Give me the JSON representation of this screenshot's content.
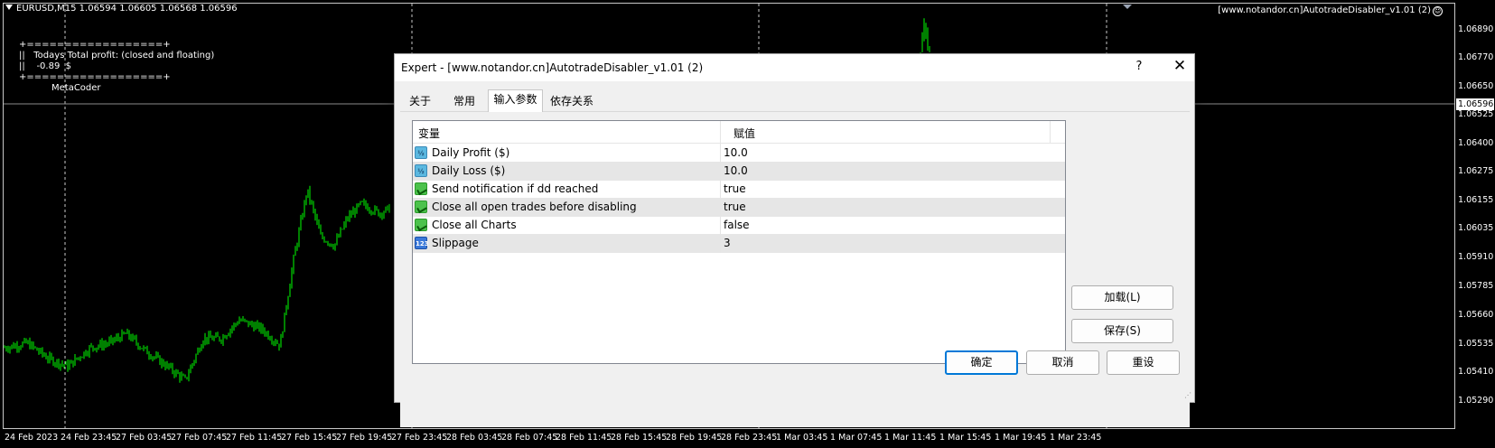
{
  "chart": {
    "title": "EURUSD,M15  1.06594 1.06605 1.06568 1.06596",
    "ea_label": "[www.notandor.cn]AutotradeDisabler_v1.01 (2)",
    "smiley": "☺",
    "overlay": {
      "line1": "+==================+",
      "line2": "||   Todays Total profit: (closed and floating)",
      "line3": "||    -0.89  $",
      "line4": "+==================+",
      "line5": "MetaCoder"
    },
    "price_labels": [
      "1.06890",
      "1.06770",
      "1.06650",
      "1.06525",
      "1.06400",
      "1.06275",
      "1.06155",
      "1.06035",
      "1.05910",
      "1.05785",
      "1.05660",
      "1.05535",
      "1.05410",
      "1.05290"
    ],
    "current_price": "1.06596",
    "time_labels": [
      "24 Feb 2023",
      "24 Feb 23:45",
      "27 Feb 03:45",
      "27 Feb 07:45",
      "27 Feb 11:45",
      "27 Feb 15:45",
      "27 Feb 19:45",
      "27 Feb 23:45",
      "28 Feb 03:45",
      "28 Feb 07:45",
      "28 Feb 11:45",
      "28 Feb 15:45",
      "28 Feb 19:45",
      "28 Feb 23:45",
      "1 Mar 03:45",
      "1 Mar 07:45",
      "1 Mar 11:45",
      "1 Mar 15:45",
      "1 Mar 19:45",
      "1 Mar 23:45"
    ],
    "colors": {
      "background": "#000000",
      "candles": "#00ff00",
      "grid": "#c8c8c8",
      "text": "#ffffff"
    }
  },
  "dialog": {
    "title": "Expert - [www.notandor.cn]AutotradeDisabler_v1.01 (2)",
    "help": "?",
    "close": "✕",
    "tabs": [
      "关于",
      "常用",
      "输入参数",
      "依存关系"
    ],
    "active_tab": "输入参数",
    "grid": {
      "col_variable": "变量",
      "col_value": "赋值",
      "rows": [
        {
          "icon": "half-icon",
          "icon_text": "½",
          "variable": "Daily Profit ($)",
          "value": "10.0"
        },
        {
          "icon": "half-icon",
          "icon_text": "½",
          "variable": "Daily Loss ($)",
          "value": "10.0"
        },
        {
          "icon": "bool-icon",
          "icon_text": "",
          "variable": "Send notification if dd reached",
          "value": "true"
        },
        {
          "icon": "bool-icon",
          "icon_text": "",
          "variable": "Close all open trades before disabling",
          "value": "true"
        },
        {
          "icon": "bool-icon",
          "icon_text": "",
          "variable": "Close all Charts",
          "value": "false"
        },
        {
          "icon": "int-icon",
          "icon_text": "123",
          "variable": "Slippage",
          "value": "3"
        }
      ]
    },
    "buttons": {
      "load": "加载(L)",
      "save": "保存(S)",
      "ok": "确定",
      "cancel": "取消",
      "reset": "重设"
    },
    "accent": "#0078d7"
  }
}
